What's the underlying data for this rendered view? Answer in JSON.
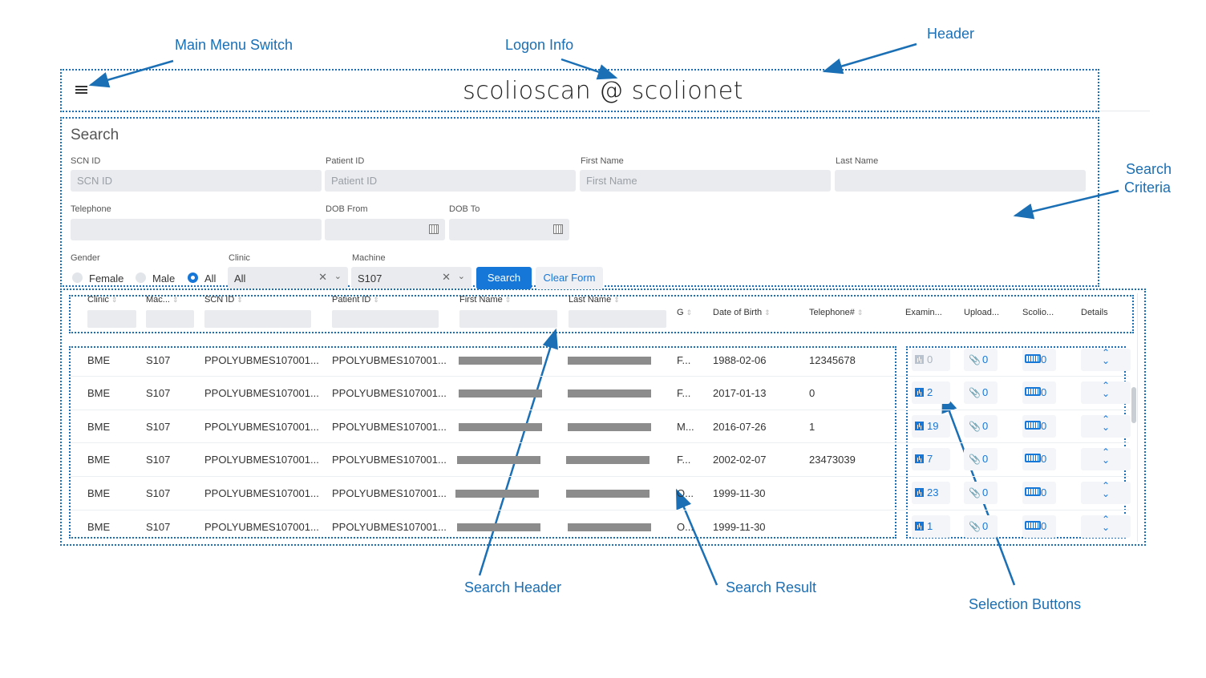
{
  "callouts": {
    "main_menu_switch": "Main Menu Switch",
    "logon_info": "Logon Info",
    "header": "Header",
    "search_criteria_line1": "Search",
    "search_criteria_line2": "Criteria",
    "search_header": "Search Header",
    "search_result": "Search Result",
    "selection_buttons": "Selection Buttons"
  },
  "header": {
    "title": "scolioscan @ scolionet",
    "menu_icon": "hamburger-icon"
  },
  "search": {
    "title": "Search",
    "fields": {
      "scn_id": {
        "label": "SCN ID",
        "placeholder": "SCN ID"
      },
      "patient_id": {
        "label": "Patient ID",
        "placeholder": "Patient ID"
      },
      "first_name": {
        "label": "First Name",
        "placeholder": "First Name"
      },
      "last_name": {
        "label": "Last Name",
        "placeholder": ""
      },
      "telephone": {
        "label": "Telephone",
        "placeholder": ""
      },
      "dob_from": {
        "label": "DOB From",
        "value": ""
      },
      "dob_to": {
        "label": "DOB To",
        "value": ""
      }
    },
    "gender": {
      "label": "Gender",
      "options": [
        "Female",
        "Male",
        "All"
      ],
      "selected": "All"
    },
    "clinic": {
      "label": "Clinic",
      "value": "All"
    },
    "machine": {
      "label": "Machine",
      "value": "S107"
    },
    "search_button": "Search",
    "clear_button": "Clear Form"
  },
  "table": {
    "columns": [
      "Clinic",
      "Mac...",
      "SCN ID",
      "Patient ID",
      "First Name",
      "Last Name",
      "G",
      "Date of Birth",
      "Telephone#",
      "Examin...",
      "Upload...",
      "Scolio...",
      "Details"
    ],
    "rows": [
      {
        "clinic": "BME",
        "machine": "S107",
        "scn_id": "PPOLYUBMES107001...",
        "patient_id": "PPOLYUBMES107001...",
        "gender": "F...",
        "dob": "1988-02-06",
        "telephone": "12345678",
        "exams": "0",
        "uploads": "0",
        "scolio": "0"
      },
      {
        "clinic": "BME",
        "machine": "S107",
        "scn_id": "PPOLYUBMES107001...",
        "patient_id": "PPOLYUBMES107001...",
        "gender": "F...",
        "dob": "2017-01-13",
        "telephone": "0",
        "exams": "2",
        "uploads": "0",
        "scolio": "0"
      },
      {
        "clinic": "BME",
        "machine": "S107",
        "scn_id": "PPOLYUBMES107001...",
        "patient_id": "PPOLYUBMES107001...",
        "gender": "M...",
        "dob": "2016-07-26",
        "telephone": "1",
        "exams": "19",
        "uploads": "0",
        "scolio": "0"
      },
      {
        "clinic": "BME",
        "machine": "S107",
        "scn_id": "PPOLYUBMES107001...",
        "patient_id": "PPOLYUBMES107001...",
        "gender": "F...",
        "dob": "2002-02-07",
        "telephone": "23473039",
        "exams": "7",
        "uploads": "0",
        "scolio": "0"
      },
      {
        "clinic": "BME",
        "machine": "S107",
        "scn_id": "PPOLYUBMES107001...",
        "patient_id": "PPOLYUBMES107001...",
        "gender": "O...",
        "dob": "1999-11-30",
        "telephone": "",
        "exams": "23",
        "uploads": "0",
        "scolio": "0"
      },
      {
        "clinic": "BME",
        "machine": "S107",
        "scn_id": "PPOLYUBMES107001...",
        "patient_id": "PPOLYUBMES107001...",
        "gender": "O...",
        "dob": "1999-11-30",
        "telephone": "",
        "exams": "1",
        "uploads": "0",
        "scolio": "0"
      }
    ]
  },
  "colors": {
    "annotation": "#1a6fb5",
    "primary": "#1677d8",
    "input_bg": "#e9ebee",
    "redaction": "#8c8c8c"
  }
}
